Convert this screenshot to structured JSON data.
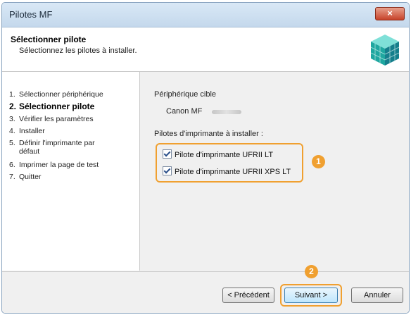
{
  "window": {
    "title": "Pilotes MF",
    "close_glyph": "×"
  },
  "header": {
    "title": "Sélectionner pilote",
    "subtitle": "Sélectionnez les pilotes à installer.",
    "icon": "installer-cube-icon"
  },
  "steps": [
    {
      "num": "1.",
      "label": "Sélectionner périphérique",
      "active": false
    },
    {
      "num": "2.",
      "label": "Sélectionner pilote",
      "active": true
    },
    {
      "num": "3.",
      "label": "Vérifier les paramètres",
      "active": false
    },
    {
      "num": "4.",
      "label": "Installer",
      "active": false
    },
    {
      "num": "5.",
      "label": "Définir l'imprimante par",
      "label2": "défaut",
      "active": false
    },
    {
      "num": "6.",
      "label": "Imprimer la page de test",
      "active": false
    },
    {
      "num": "7.",
      "label": "Quitter",
      "active": false
    }
  ],
  "content": {
    "device_label": "Périphérique cible",
    "device_value": "Canon MF",
    "drivers_label": "Pilotes d'imprimante à installer :",
    "drivers": [
      {
        "label": "Pilote d'imprimante UFRII LT",
        "checked": true
      },
      {
        "label": "Pilote d'imprimante UFRII XPS LT",
        "checked": true
      }
    ]
  },
  "callouts": {
    "one": "1",
    "two": "2"
  },
  "footer": {
    "prev_label": "< Précédent",
    "next_label": "Suivant >",
    "cancel_label": "Annuler"
  },
  "colors": {
    "highlight": "#f0a030",
    "title_bar": "#c4d8ec"
  }
}
